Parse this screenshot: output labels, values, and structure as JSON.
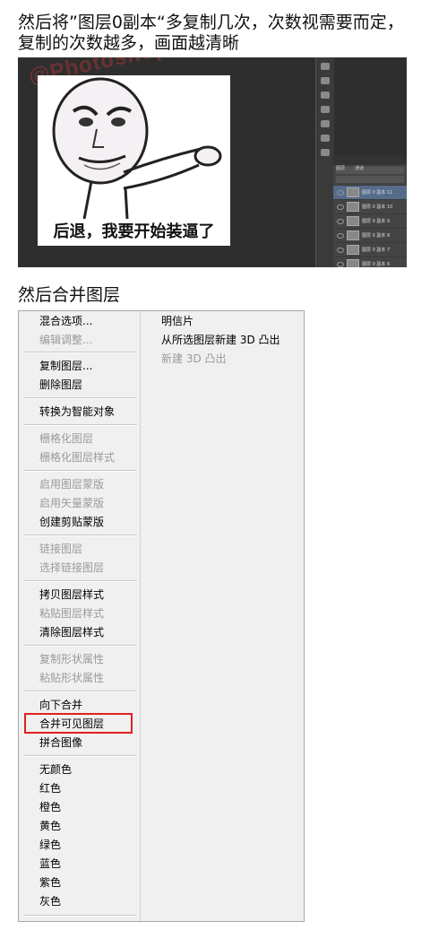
{
  "intro_text": "然后将”图层0副本“多复制几次，次数视需要而定，复制的次数越多，画面越清晰",
  "screenshot1": {
    "watermark": "@Photoshop教程",
    "meme_caption": "后退，我要开始装逼了",
    "layers_panel": {
      "tabs": [
        "图层",
        "通道"
      ],
      "layers": [
        "图层 0 副本 11",
        "图层 0 副本 10",
        "图层 0 副本 9",
        "图层 0 副本 8",
        "图层 0 副本 7",
        "图层 0 副本 6"
      ]
    }
  },
  "heading2": "然后合并图层",
  "context_menu": {
    "col1": {
      "items": [
        {
          "label": "混合选项...",
          "enabled": true
        },
        {
          "label": "编辑调整...",
          "enabled": false
        },
        {
          "label": "复制图层...",
          "enabled": true
        },
        {
          "label": "删除图层",
          "enabled": true
        },
        {
          "label": "转换为智能对象",
          "enabled": true
        },
        {
          "label": "栅格化图层",
          "enabled": false
        },
        {
          "label": "栅格化图层样式",
          "enabled": false
        },
        {
          "label": "启用图层蒙版",
          "enabled": false
        },
        {
          "label": "启用矢量蒙版",
          "enabled": false
        },
        {
          "label": "创建剪贴蒙版",
          "enabled": true
        },
        {
          "label": "链接图层",
          "enabled": false
        },
        {
          "label": "选择链接图层",
          "enabled": false
        },
        {
          "label": "拷贝图层样式",
          "enabled": true
        },
        {
          "label": "粘贴图层样式",
          "enabled": false
        },
        {
          "label": "清除图层样式",
          "enabled": true
        },
        {
          "label": "复制形状属性",
          "enabled": false
        },
        {
          "label": "粘贴形状属性",
          "enabled": false
        },
        {
          "label": "向下合并",
          "enabled": true
        },
        {
          "label": "合并可见图层",
          "enabled": true
        },
        {
          "label": "拼合图像",
          "enabled": true
        },
        {
          "label": "无颜色",
          "enabled": true
        },
        {
          "label": "红色",
          "enabled": true
        },
        {
          "label": "橙色",
          "enabled": true
        },
        {
          "label": "黄色",
          "enabled": true
        },
        {
          "label": "绿色",
          "enabled": true
        },
        {
          "label": "蓝色",
          "enabled": true
        },
        {
          "label": "紫色",
          "enabled": true
        },
        {
          "label": "灰色",
          "enabled": true
        }
      ]
    },
    "col2": {
      "items": [
        {
          "label": "明信片",
          "enabled": true
        },
        {
          "label": "从所选图层新建 3D 凸出",
          "enabled": true
        },
        {
          "label": "新建 3D 凸出",
          "enabled": false
        }
      ]
    },
    "highlighted_item": "合并可见图层",
    "highlight_color": "#e02020"
  }
}
